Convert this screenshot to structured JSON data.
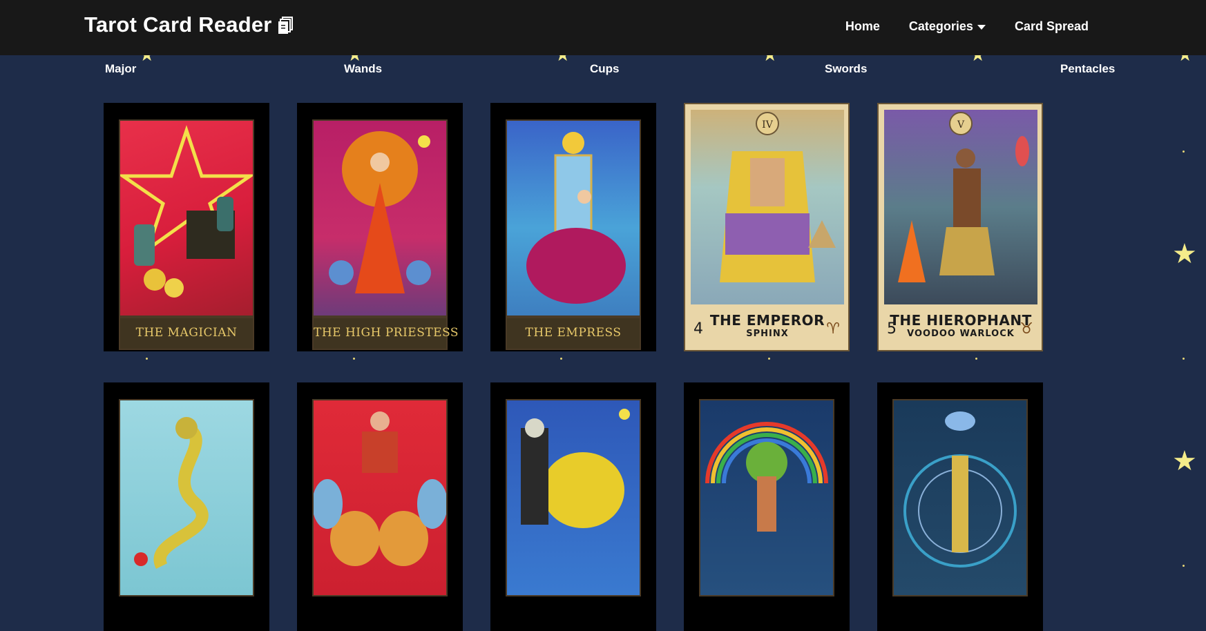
{
  "app": {
    "title": "Tarot Card Reader"
  },
  "nav": {
    "items": [
      "Home",
      "Categories",
      "Card Spread"
    ]
  },
  "categories": [
    "Major",
    "Wands",
    "Cups",
    "Swords",
    "Pentacles"
  ],
  "cards_row1": [
    {
      "label": "THE MAGICIAN"
    },
    {
      "label": "THE HIGH PRIESTESS"
    },
    {
      "label": "THE EMPRESS"
    },
    {
      "label": "THE EMPEROR",
      "subtitle": "SPHINX",
      "number": "4",
      "roman": "IV"
    },
    {
      "label": "THE HIEROPHANT",
      "subtitle": "VOODOO WARLOCK",
      "number": "5",
      "roman": "V"
    }
  ],
  "colors": {
    "page_bg": "#1e2c49",
    "navbar_bg": "#181818",
    "star": "#f4ec8a"
  },
  "icons": {
    "brand": "cards-stack-icon",
    "categories": "caret-down-icon",
    "decoration": "star-icon"
  }
}
